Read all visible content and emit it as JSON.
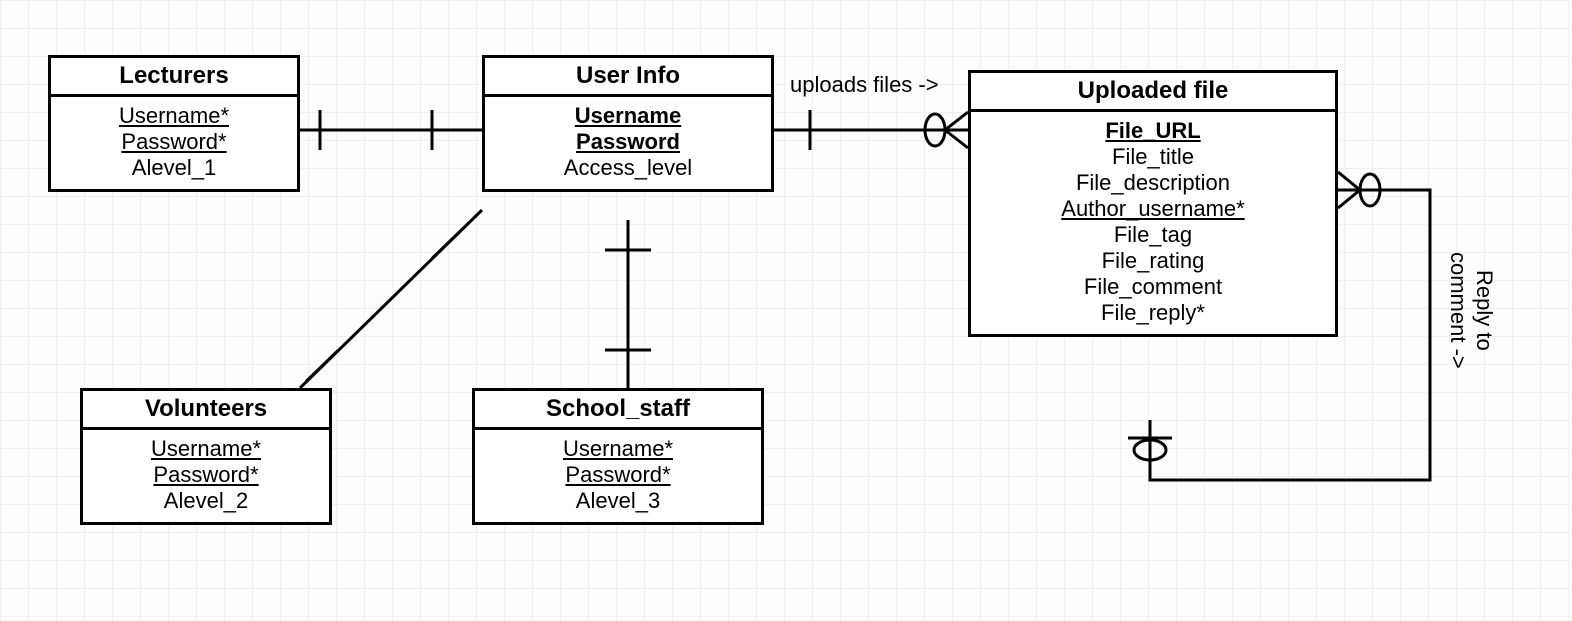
{
  "entities": {
    "lecturers": {
      "title": "Lecturers",
      "attrs": [
        "Username*",
        "Password*",
        "Alevel_1"
      ],
      "attr_underline": [
        true,
        true,
        false
      ]
    },
    "userinfo": {
      "title": "User Info",
      "attrs": [
        "Username",
        "Password",
        "Access_level"
      ],
      "attr_underline": [
        true,
        true,
        false
      ],
      "attr_bold": [
        true,
        true,
        false
      ]
    },
    "uploaded": {
      "title": "Uploaded file",
      "attrs": [
        "File_URL",
        "File_title",
        "File_description",
        "Author_username*",
        "File_tag",
        "File_rating",
        "File_comment",
        "File_reply*"
      ],
      "attr_underline": [
        true,
        false,
        false,
        true,
        false,
        false,
        false,
        false
      ],
      "attr_bold": [
        true,
        false,
        false,
        false,
        false,
        false,
        false,
        false
      ]
    },
    "volunteers": {
      "title": "Volunteers",
      "attrs": [
        "Username*",
        "Password*",
        "Alevel_2"
      ],
      "attr_underline": [
        true,
        true,
        false
      ]
    },
    "schoolstaff": {
      "title": "School_staff",
      "attrs": [
        "Username*",
        "Password*",
        "Alevel_3"
      ],
      "attr_underline": [
        true,
        true,
        false
      ]
    }
  },
  "labels": {
    "uploads": "uploads files ->",
    "reply": "Reply to\ncomment ->"
  }
}
